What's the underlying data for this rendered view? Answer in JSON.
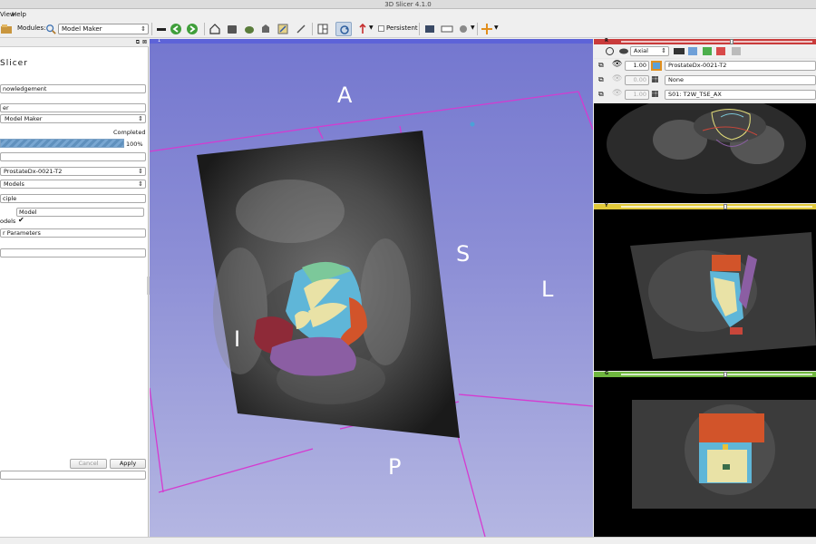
{
  "window": {
    "title": "3D Slicer 4.1.0"
  },
  "menu": {
    "items": [
      "View",
      "Help"
    ]
  },
  "toolbar": {
    "modules_label": "Modules:",
    "module_value": "Model Maker",
    "persistent_label": "Persistent"
  },
  "left_panel": {
    "logo_text": "Slicer",
    "acknowledgement_label": "nowledgement",
    "section_label": "er",
    "module_select": "Model Maker",
    "progress_status": "Completed",
    "progress_percent": "100%",
    "progress_value": 1.0,
    "volume_select": "ProstateDx-0021-T2",
    "models_select": "Models",
    "principle_label": "ciple",
    "model_name": "Model",
    "joint_models_label": "odels",
    "advanced_label": "r Parameters",
    "cancel_button": "Cancel",
    "apply_button": "Apply"
  },
  "view3d": {
    "badge": "1",
    "orientation": {
      "anterior": "A",
      "superior": "S",
      "left": "L",
      "inferior": "I",
      "posterior": "P"
    }
  },
  "slice_controls": {
    "view_select": "Axial",
    "fg_opacity": "1.00",
    "fg_volume": "ProstateDx-0021-T2",
    "label_opacity": "0.00",
    "label_volume": "None",
    "bg_opacity": "1.00",
    "bg_volume": "S01: T2W_TSE_AX"
  },
  "slice_bars": {
    "red": {
      "tag": "R",
      "color": "#c93b3b"
    },
    "yellow": {
      "tag": "Y",
      "color": "#e1c93a"
    },
    "green": {
      "tag": "G",
      "color": "#6fb63f"
    }
  },
  "colors": {
    "view3d_bar": "#5d63d8",
    "bounding_box": "#d53ad0",
    "progress_fill": "#5f90bd"
  }
}
